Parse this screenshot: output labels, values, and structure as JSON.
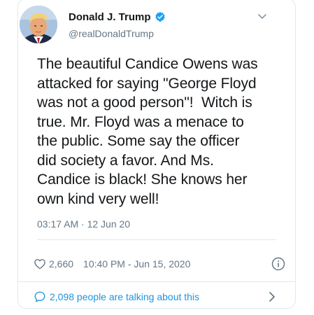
{
  "tweet": {
    "display_name": "Donald J. Trump",
    "handle": "@realDonaldTrump",
    "text": "The beautiful Candice Owens was\nattacked for saying \"George Floyd\nwas not a good person\"!  Witch is\ntrue. Mr. Floyd was a menace to\nthe public. Some say the officer\ndid society a favor. And Ms.\nCandice is black! She knows her\nown kind very well!",
    "timestamp": "03:17 AM · 12 Jun 20"
  },
  "stats": {
    "likes": "2,660",
    "time": "10:40 PM - Jun 15, 2020"
  },
  "footer": {
    "talking": "2,098 people are talking about this"
  },
  "colors": {
    "text": "#14171a",
    "muted": "#657786",
    "accent": "#1b95e0",
    "divider": "#e1e8ed",
    "verified": "#1da1f2"
  },
  "icons": [
    "verified-badge-icon",
    "chevron-down-icon",
    "heart-icon",
    "info-icon",
    "comment-icon",
    "chevron-right-icon"
  ]
}
